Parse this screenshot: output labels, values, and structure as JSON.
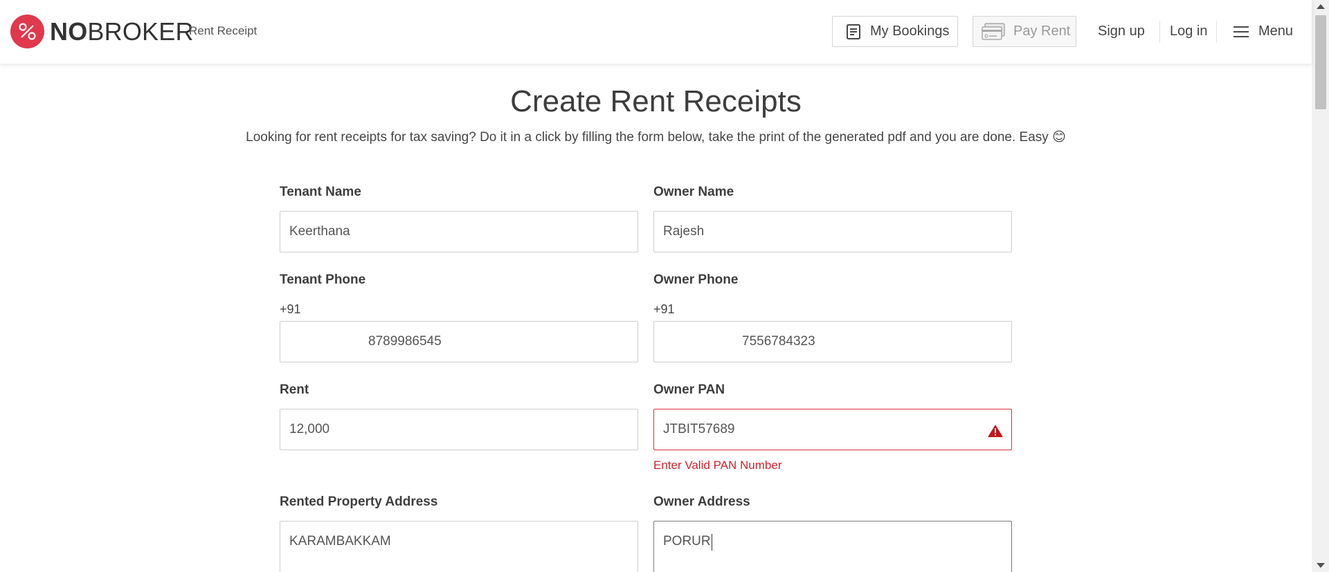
{
  "header": {
    "brand_bold": "NO",
    "brand_light": "BROKER",
    "brand_sub": "Rent Receipt",
    "bookings_label": "My Bookings",
    "payrent_label": "Pay Rent",
    "signup_label": "Sign up",
    "login_label": "Log in",
    "menu_label": "Menu"
  },
  "page": {
    "title": "Create Rent Receipts",
    "subtitle": "Looking for rent receipts for tax saving? Do it in a click by filling the form below, take the print of the generated pdf and you are done. Easy 😊"
  },
  "form": {
    "tenant_name": {
      "label": "Tenant Name",
      "value": "Keerthana"
    },
    "owner_name": {
      "label": "Owner Name",
      "value": "Rajesh"
    },
    "tenant_phone": {
      "label": "Tenant Phone",
      "prefix": "+91",
      "value": "8789986545"
    },
    "owner_phone": {
      "label": "Owner Phone",
      "prefix": "+91",
      "value": "7556784323"
    },
    "rent": {
      "label": "Rent",
      "value": "12,000"
    },
    "owner_pan": {
      "label": "Owner PAN",
      "value": "JTBIT57689",
      "error": "Enter Valid PAN Number"
    },
    "property_address": {
      "label": "Rented Property Address",
      "value": "KARAMBAKKAM"
    },
    "owner_address": {
      "label": "Owner Address",
      "value": "PORUR"
    }
  },
  "colors": {
    "brand": "#e0384d",
    "error": "#d0212a"
  },
  "icons": {
    "logo": "nobroker-logo-icon",
    "bookings": "document-list-icon",
    "payrent": "credit-card-icon",
    "menu": "hamburger-icon",
    "warning": "warning-triangle-icon"
  }
}
